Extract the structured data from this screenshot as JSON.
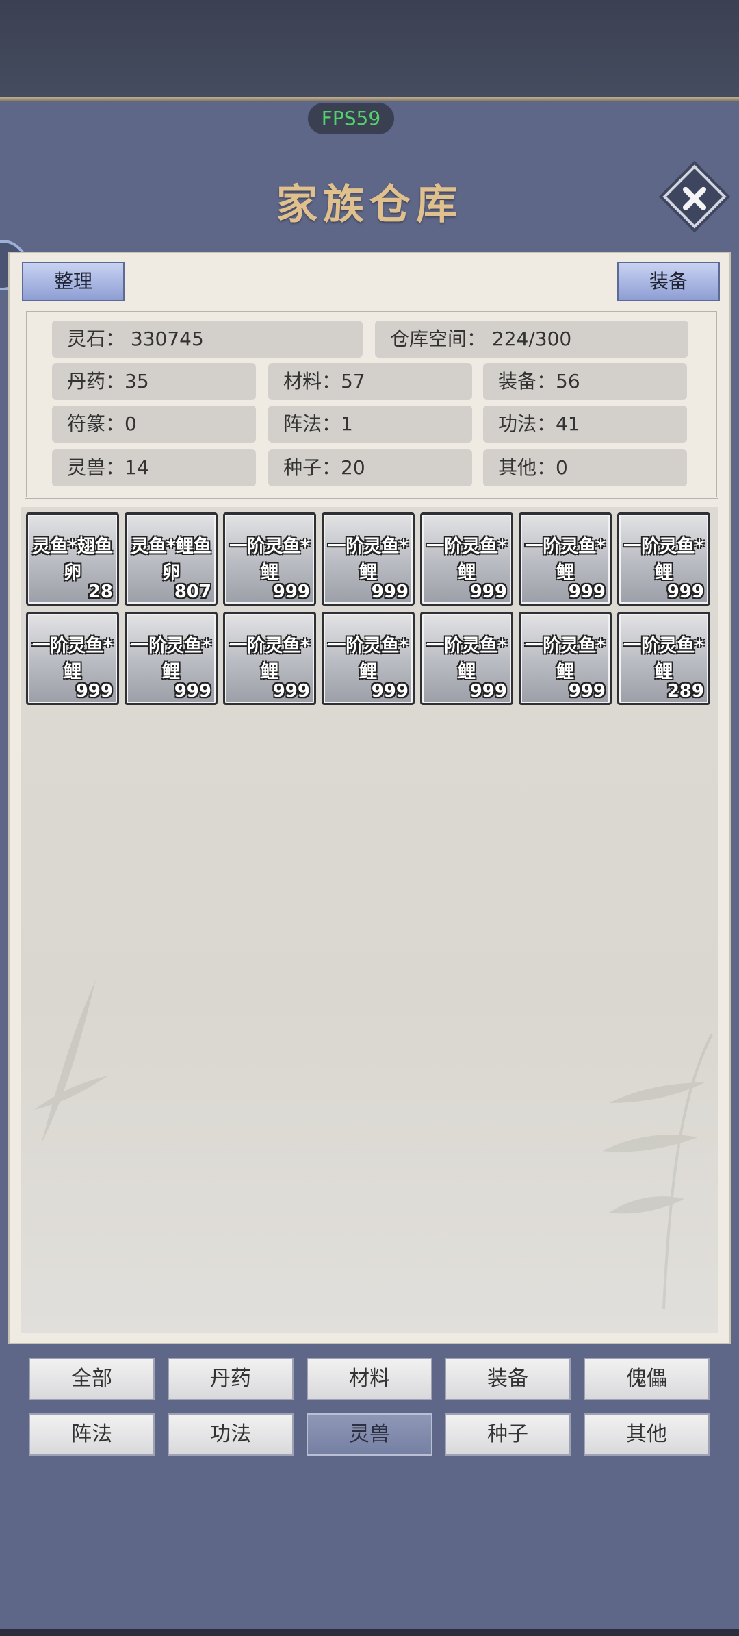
{
  "fps": "FPS59",
  "title": "家族仓库",
  "buttons": {
    "organize": "整理",
    "equip": "装备"
  },
  "stats": {
    "spirit_stone": "灵石：  330745",
    "storage_space": "仓库空间：    224/300",
    "elixir": "丹药：35",
    "material": "材料：57",
    "equipment": "装备：56",
    "talisman": "符篆：0",
    "formation": "阵法：1",
    "technique": "功法：41",
    "spirit_beast": "灵兽：14",
    "seed": "种子：20",
    "other": "其他：0"
  },
  "items": [
    {
      "name": "灵鱼*翅鱼卵",
      "qty": "28"
    },
    {
      "name": "灵鱼*鲤鱼卵",
      "qty": "807"
    },
    {
      "name": "一阶灵鱼*鲤",
      "qty": "999"
    },
    {
      "name": "一阶灵鱼*鲤",
      "qty": "999"
    },
    {
      "name": "一阶灵鱼*鲤",
      "qty": "999"
    },
    {
      "name": "一阶灵鱼*鲤",
      "qty": "999"
    },
    {
      "name": "一阶灵鱼*鲤",
      "qty": "999"
    },
    {
      "name": "一阶灵鱼*鲤",
      "qty": "999"
    },
    {
      "name": "一阶灵鱼*鲤",
      "qty": "999"
    },
    {
      "name": "一阶灵鱼*鲤",
      "qty": "999"
    },
    {
      "name": "一阶灵鱼*鲤",
      "qty": "999"
    },
    {
      "name": "一阶灵鱼*鲤",
      "qty": "999"
    },
    {
      "name": "一阶灵鱼*鲤",
      "qty": "999"
    },
    {
      "name": "一阶灵鱼*鲤",
      "qty": "289"
    }
  ],
  "tabs": [
    "全部",
    "丹药",
    "材料",
    "装备",
    "傀儡",
    "阵法",
    "功法",
    "灵兽",
    "种子",
    "其他"
  ],
  "active_tab": "灵兽",
  "colors": {
    "background": "#5f6789",
    "title": "#e0c08d",
    "fps": "#52d16b",
    "panel": "#efebe3"
  },
  "icons": {
    "close": "close-icon"
  }
}
